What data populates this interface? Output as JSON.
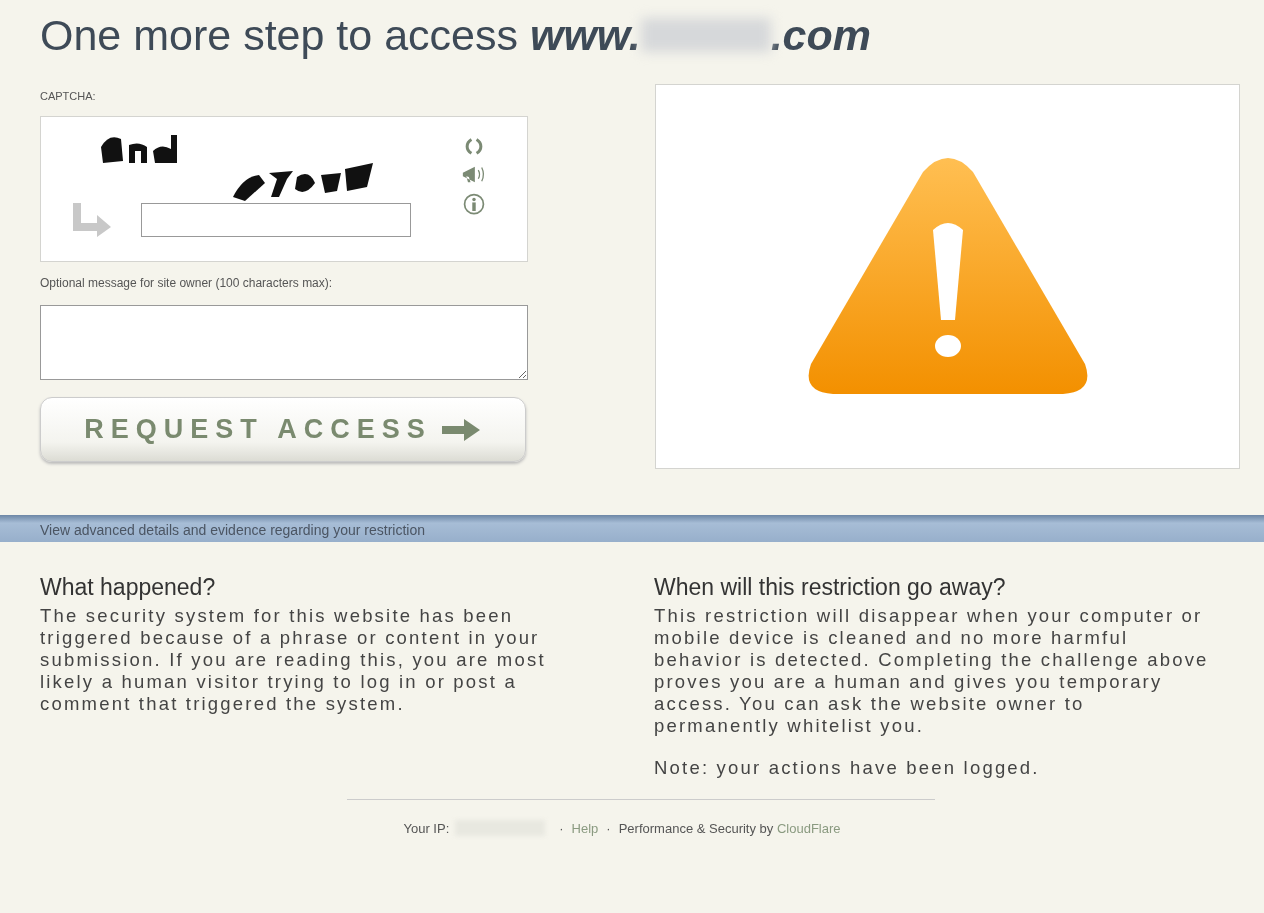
{
  "heading": {
    "text": "One more step to access ",
    "domain_prefix": "www.",
    "domain_suffix": ".com"
  },
  "captcha": {
    "label": "CAPTCHA:"
  },
  "message": {
    "label": "Optional message for site owner (100 characters max):"
  },
  "request_button": {
    "label": "REQUEST ACCESS"
  },
  "details_bar": {
    "text": "View advanced details and evidence regarding your restriction"
  },
  "sections": [
    {
      "title": "What happened?",
      "paragraphs": [
        "The security system for this website has been triggered because of a phrase or content in your submission. If you are reading this, you are most likely a human visitor trying to log in or post a comment that triggered the system."
      ]
    },
    {
      "title": "When will this restriction go away?",
      "paragraphs": [
        "This restriction will disappear when your computer or mobile device is cleaned and no more harmful behavior is detected. Completing the challenge above proves you are a human and gives you temporary access. You can ask the website owner to permanently whitelist you.",
        "Note: your actions have been logged."
      ]
    }
  ],
  "footer": {
    "ip_label": "Your IP:",
    "separator": "·",
    "help": "Help",
    "performance": "Performance & Security by ",
    "provider": "CloudFlare"
  }
}
